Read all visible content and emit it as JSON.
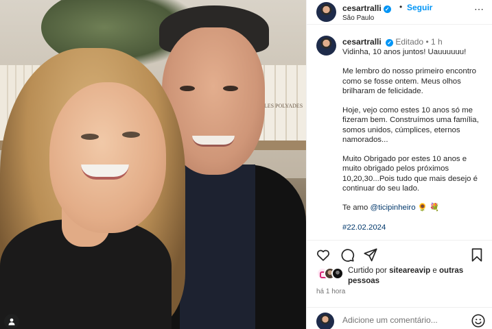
{
  "photo": {
    "book_label": "LES POLYADES",
    "user_tag_icon": "person-icon"
  },
  "header": {
    "username": "cesartralli",
    "verified_icon": "verified-badge-icon",
    "separator": "•",
    "follow_label": "Seguir",
    "location": "São Paulo",
    "more_icon": "more-options-icon",
    "more_label": "⋯"
  },
  "caption": {
    "username": "cesartralli",
    "edited_label": "Editado",
    "separator": "•",
    "time": "1 h",
    "lines": [
      "Vidinha, 10 anos juntos! Uauuuuuu!",
      "Me lembro do nosso primeiro encontro como se fosse ontem. Meus olhos brilharam de felicidade.",
      "Hoje, vejo como estes 10 anos só me fizeram bem. Construímos uma família, somos unidos, cúmplices, eternos namorados...",
      "Muito Obrigado por estes 10 anos e muito obrigado pelos próximos 10,20,30...Pois tudo que mais desejo é continuar do seu lado."
    ],
    "closing_prefix": "Te amo",
    "mention": "@ticipinheiro",
    "closing_emojis": "🌻 💐",
    "date_partial": "#22.02.2024"
  },
  "actions": {
    "like_icon": "heart-icon",
    "comment_icon": "comment-icon",
    "share_icon": "share-icon",
    "save_icon": "bookmark-icon"
  },
  "likes": {
    "prefix": "Curtido por",
    "user": "siteareavip",
    "connector": "e",
    "others": "outras pessoas"
  },
  "time_ago": "há 1 hora",
  "comment": {
    "placeholder": "Adicione um comentário...",
    "emoji_icon": "emoji-icon"
  },
  "colors": {
    "accent": "#0095f6",
    "mention": "#00376b",
    "text": "#262626",
    "muted": "#737373"
  }
}
